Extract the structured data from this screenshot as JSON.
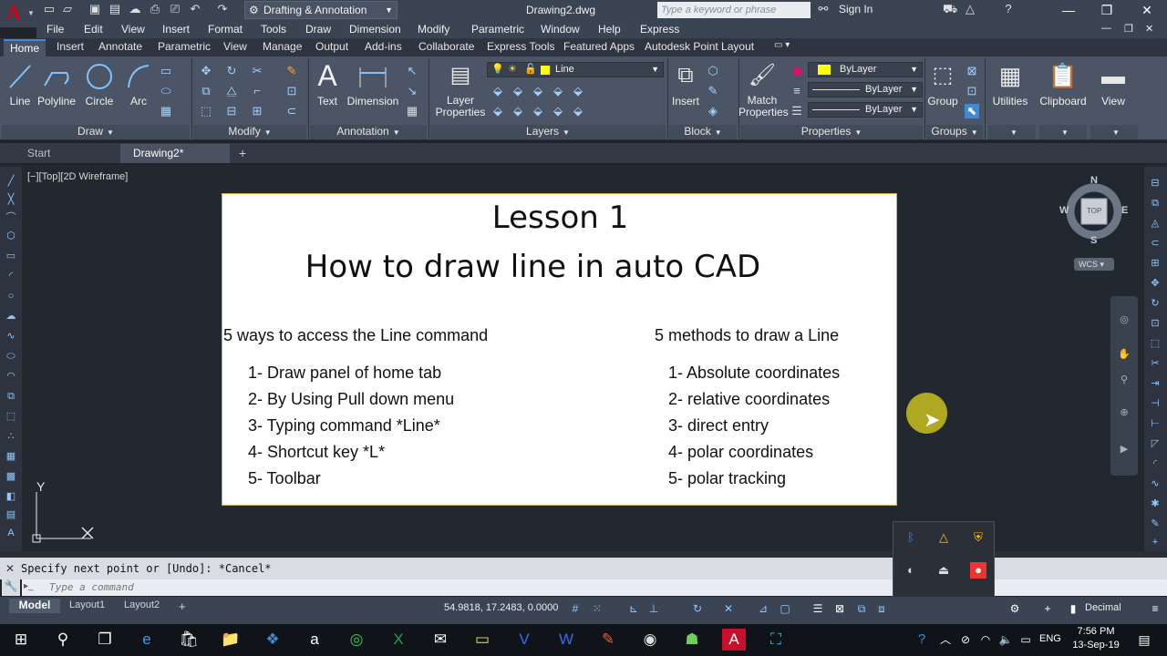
{
  "app": {
    "workspace": "Drafting & Annotation",
    "document_title": "Drawing2.dwg",
    "search_placeholder": "Type a keyword or phrase",
    "sign_in": "Sign In"
  },
  "menubar": [
    "File",
    "Edit",
    "View",
    "Insert",
    "Format",
    "Tools",
    "Draw",
    "Dimension",
    "Modify",
    "Parametric",
    "Window",
    "Help",
    "Express"
  ],
  "ribbon_tabs": [
    "Home",
    "Insert",
    "Annotate",
    "Parametric",
    "View",
    "Manage",
    "Output",
    "Add-ins",
    "Collaborate",
    "Express Tools",
    "Featured Apps",
    "Autodesk Point Layout"
  ],
  "ribbon": {
    "draw": {
      "line": "Line",
      "polyline": "Polyline",
      "circle": "Circle",
      "arc": "Arc",
      "title": "Draw"
    },
    "modify": {
      "title": "Modify"
    },
    "annotation": {
      "text": "Text",
      "dimension": "Dimension",
      "title": "Annotation"
    },
    "layers": {
      "layer_properties": "Layer\nProperties",
      "current_layer": "Line",
      "title": "Layers"
    },
    "block": {
      "insert": "Insert",
      "title": "Block"
    },
    "properties": {
      "match": "Match\nProperties",
      "color": "ByLayer",
      "linetype": "ByLayer",
      "lineweight": "ByLayer",
      "title": "Properties"
    },
    "groups": {
      "group": "Group",
      "title": "Groups"
    },
    "utilities": "Utilities",
    "clipboard": "Clipboard",
    "view": "View"
  },
  "doc_tabs": {
    "start": "Start",
    "drawing": "Drawing2*"
  },
  "viewport_label": "[−][Top][2D Wireframe]",
  "viewcube": {
    "n": "N",
    "s": "S",
    "e": "E",
    "w": "W",
    "face": "TOP",
    "wcs": "WCS"
  },
  "ucs": {
    "y": "Y"
  },
  "lesson": {
    "title": "Lesson 1",
    "subtitle": "How to draw line in auto CAD",
    "left_heading": "5 ways to access the Line command",
    "left_items": [
      "1-  Draw panel of home tab",
      "2-  By Using Pull down menu",
      "3-  Typing command  *Line*",
      "4-  Shortcut key *L*",
      "5-  Toolbar"
    ],
    "right_heading": "5 methods to draw a Line",
    "right_items": [
      "1- Absolute coordinates",
      "2- relative coordinates",
      "3- direct entry",
      "4- polar coordinates",
      "5- polar tracking"
    ]
  },
  "command": {
    "history": "Specify next point or [Undo]: *Cancel*",
    "input_placeholder": "Type a command"
  },
  "status": {
    "tabs": [
      "Model",
      "Layout1",
      "Layout2"
    ],
    "coords": "54.9818, 17.2483, 0.0000",
    "units": "Decimal"
  },
  "taskbar": {
    "lang": "ENG",
    "time": "7:56 PM",
    "date": "13-Sep-19"
  }
}
